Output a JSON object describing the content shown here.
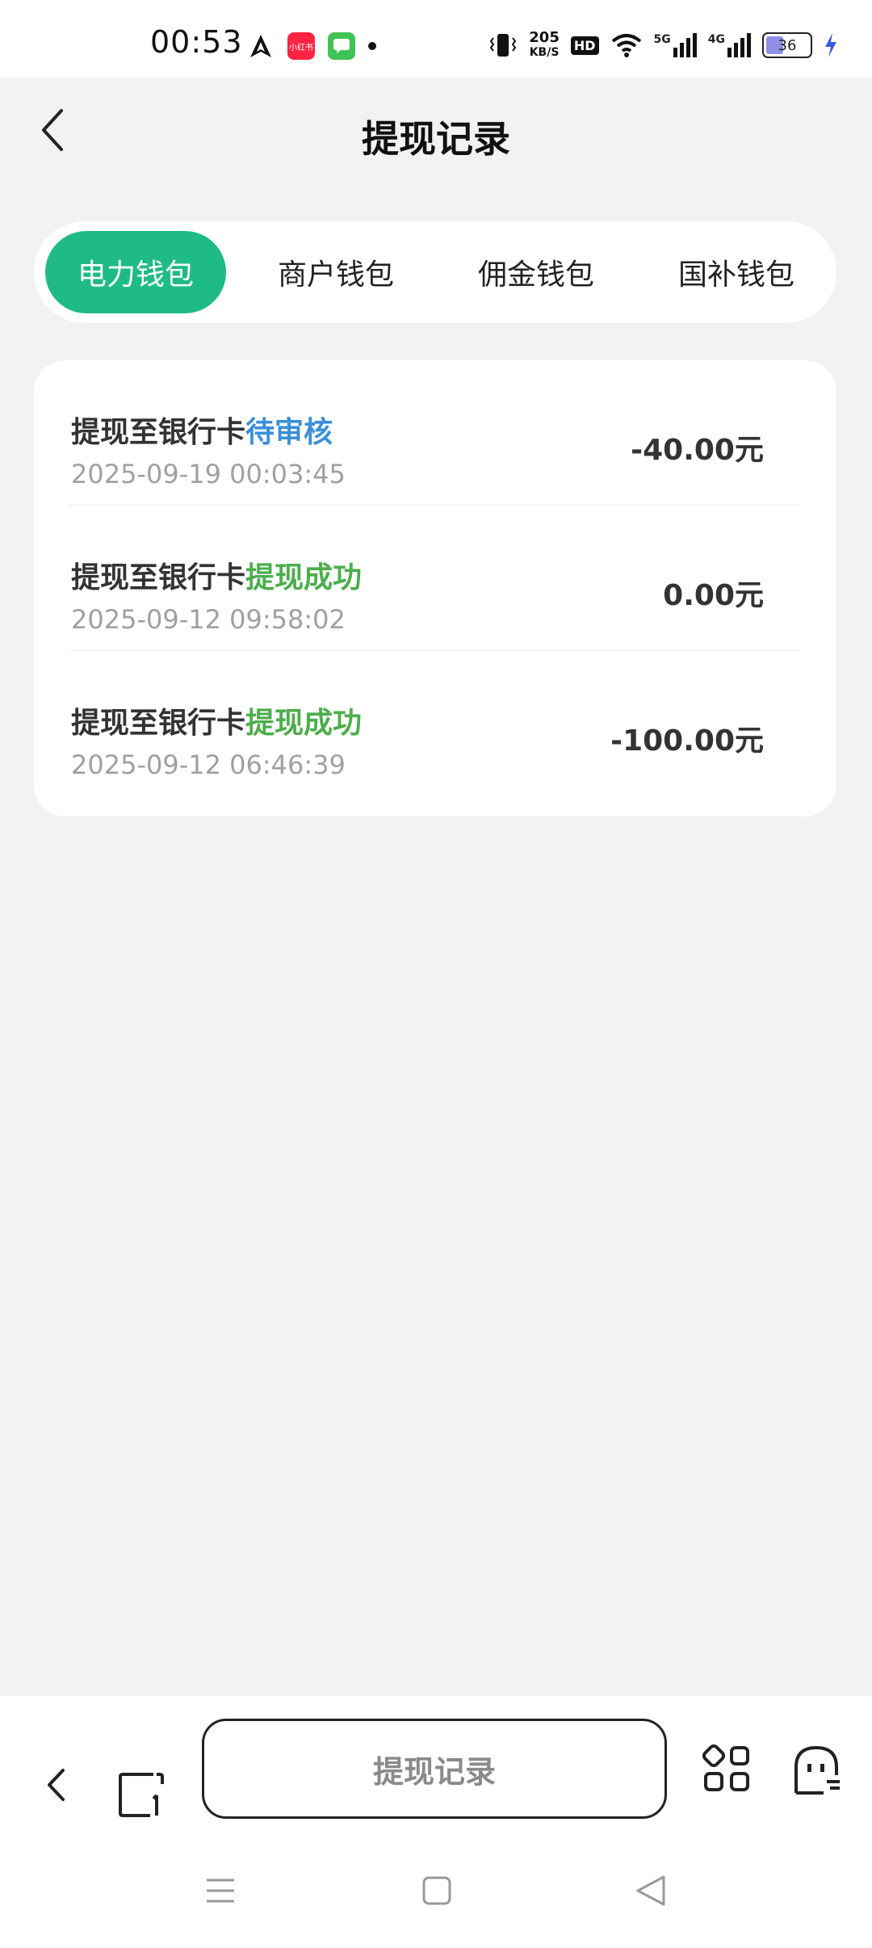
{
  "status_bar": {
    "time": "00:53",
    "app_icons": [
      "navigation-icon",
      "xiaohongshu-icon",
      "messages-icon"
    ],
    "xiaohongshu_label": "小红书",
    "speed_value": "205",
    "speed_unit": "KB/S",
    "hd_label": "HD",
    "signal_5g": "5G",
    "signal_4g": "4G",
    "battery_level": "36"
  },
  "header": {
    "title": "提现记录"
  },
  "tabs": [
    {
      "label": "电力钱包",
      "active": true
    },
    {
      "label": "商户钱包",
      "active": false
    },
    {
      "label": "佣金钱包",
      "active": false
    },
    {
      "label": "国补钱包",
      "active": false
    }
  ],
  "records": [
    {
      "title": "提现至银行卡",
      "status": "待审核",
      "status_type": "pending",
      "time": "2025-09-19 00:03:45",
      "amount": "-40.00元"
    },
    {
      "title": "提现至银行卡",
      "status": "提现成功",
      "status_type": "success",
      "time": "2025-09-12 09:58:02",
      "amount": "0.00元"
    },
    {
      "title": "提现至银行卡",
      "status": "提现成功",
      "status_type": "success",
      "time": "2025-09-12 06:46:39",
      "amount": "-100.00元"
    }
  ],
  "toolbar": {
    "center_label": "提现记录"
  },
  "colors": {
    "accent": "#1fbb87",
    "pending": "#3a8fd9",
    "success": "#4cae4c",
    "background": "#f2f2f2"
  }
}
